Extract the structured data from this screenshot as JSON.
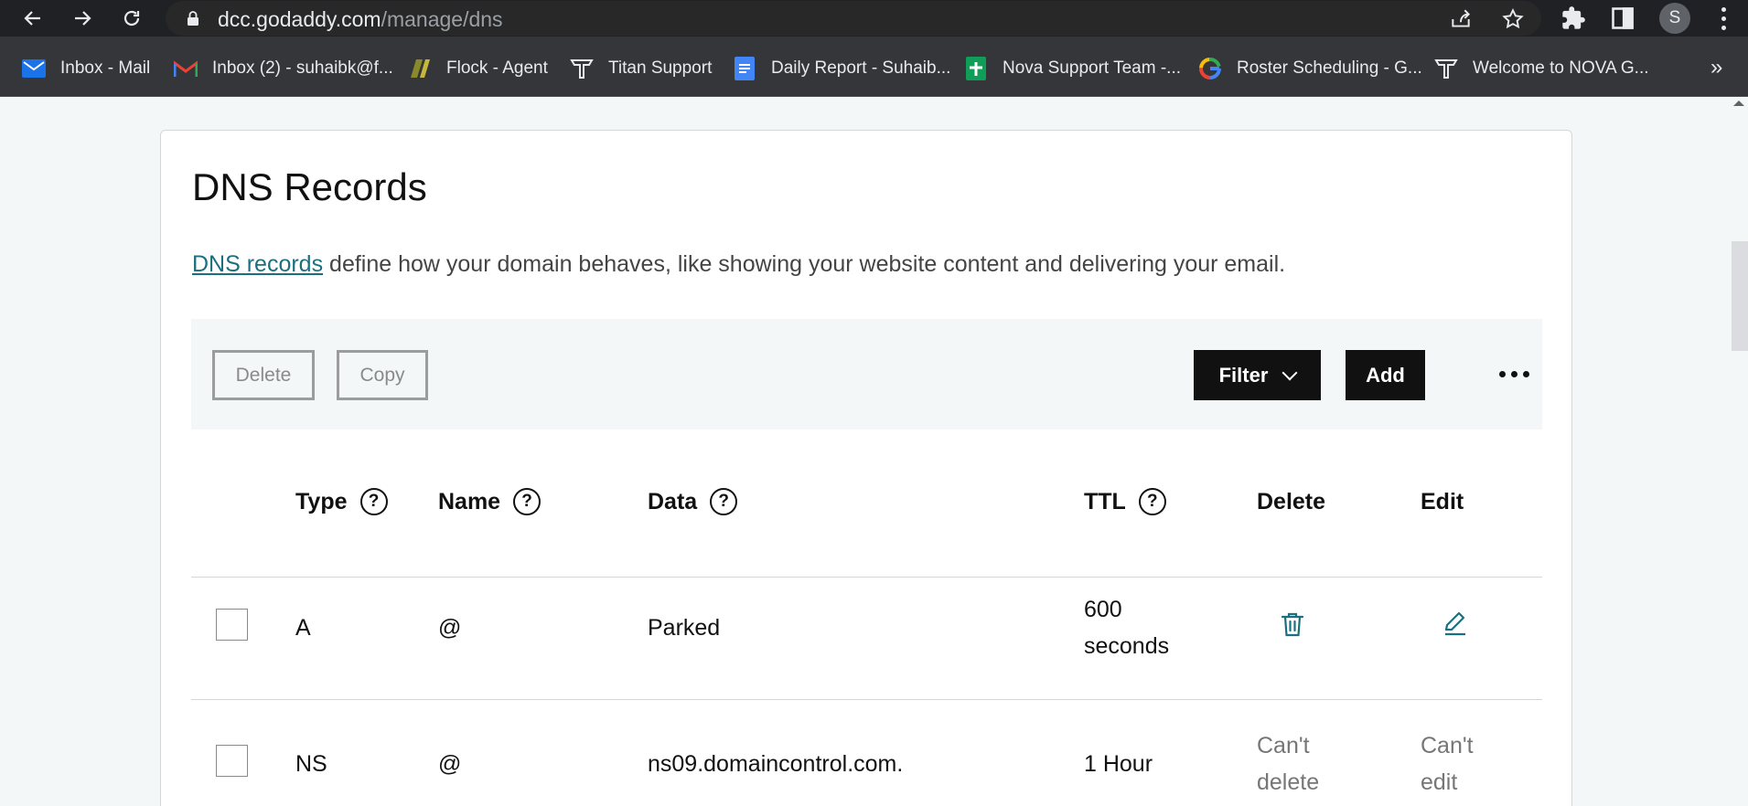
{
  "browser": {
    "url_host": "dcc.godaddy.com",
    "url_path": "/manage/dns",
    "avatar_letter": "S",
    "bookmarks": [
      {
        "label": "Inbox - Mail",
        "icon": "mail-icon"
      },
      {
        "label": "Inbox (2) - suhaibk@f...",
        "icon": "gmail-icon"
      },
      {
        "label": "Flock - Agent",
        "icon": "flock-icon"
      },
      {
        "label": "Titan Support",
        "icon": "titan-icon"
      },
      {
        "label": "Daily Report - Suhaib...",
        "icon": "docs-icon"
      },
      {
        "label": "Nova Support Team -...",
        "icon": "sheets-icon"
      },
      {
        "label": "Roster Scheduling - G...",
        "icon": "google-icon"
      },
      {
        "label": "Welcome to NOVA G...",
        "icon": "titan-icon"
      }
    ],
    "more_bookmarks": "»"
  },
  "dns": {
    "title": "DNS Records",
    "desc_link": "DNS records",
    "desc_text": " define how your domain behaves, like showing your website content and delivering your email.",
    "actions": {
      "delete": "Delete",
      "copy": "Copy",
      "filter": "Filter",
      "add": "Add"
    },
    "columns": {
      "type": "Type",
      "name": "Name",
      "data": "Data",
      "ttl": "TTL",
      "delete": "Delete",
      "edit": "Edit"
    },
    "help_glyph": "?",
    "rows": [
      {
        "type": "A",
        "name": "@",
        "data": "Parked",
        "ttl_1": "600",
        "ttl_2": "seconds"
      },
      {
        "type": "NS",
        "name": "@",
        "data": "ns09.domaincontrol.com.",
        "ttl": "1 Hour",
        "delete_1": "Can't",
        "delete_2": "delete",
        "edit_1": "Can't",
        "edit_2": "edit"
      }
    ]
  },
  "colors": {
    "link": "#1b6f80",
    "dark_button": "#111111",
    "page_bg": "#f4f7f7"
  }
}
